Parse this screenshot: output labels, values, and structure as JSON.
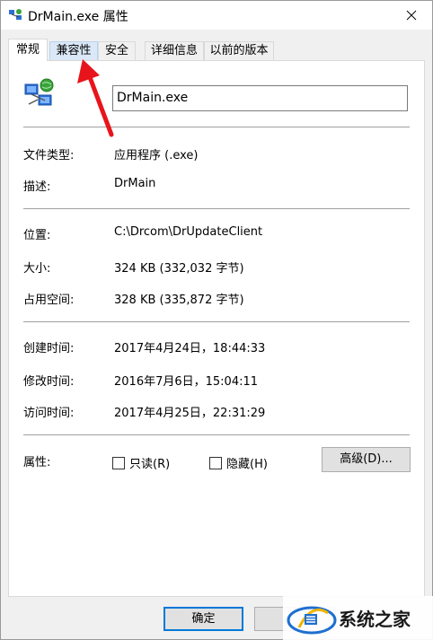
{
  "window": {
    "title": "DrMain.exe 属性"
  },
  "tabs": [
    {
      "label": "常规"
    },
    {
      "label": "兼容性"
    },
    {
      "label": "安全"
    },
    {
      "label": "详细信息"
    },
    {
      "label": "以前的版本"
    }
  ],
  "general": {
    "file_name": "DrMain.exe",
    "rows": [
      {
        "label": "文件类型:",
        "value": "应用程序 (.exe)"
      },
      {
        "label": "描述:",
        "value": "DrMain"
      },
      {
        "label": "位置:",
        "value": "C:\\Drcom\\DrUpdateClient"
      },
      {
        "label": "大小:",
        "value": "324 KB (332,032 字节)"
      },
      {
        "label": "占用空间:",
        "value": "328 KB (335,872 字节)"
      },
      {
        "label": "创建时间:",
        "value": "2017年4月24日，18:44:33"
      },
      {
        "label": "修改时间:",
        "value": "2016年7月6日，15:04:11"
      },
      {
        "label": "访问时间:",
        "value": "2017年4月25日，22:31:29"
      }
    ],
    "attributes_label": "属性:",
    "readonly_label": "只读(R)",
    "hidden_label": "隐藏(H)",
    "advanced_label": "高级(D)..."
  },
  "buttons": {
    "ok": "确定"
  },
  "watermark": {
    "text": "系统之家"
  },
  "colors": {
    "accent": "#0078d7",
    "arrow": "#e8141b"
  }
}
